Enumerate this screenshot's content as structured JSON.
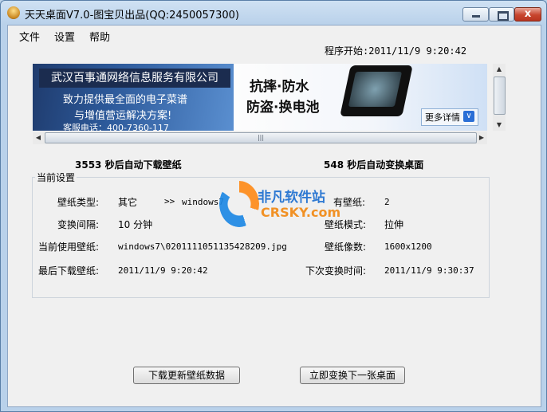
{
  "window": {
    "title": "天天桌面V7.0-图宝贝出品(QQ:2450057300)",
    "close_glyph": "x"
  },
  "menu": [
    "文件",
    "设置",
    "帮助"
  ],
  "start_time": "程序开始:2011/11/9 9:20:42",
  "ad": {
    "company": "武汉百事通网络信息服务有限公司",
    "slogan1": "致力提供最全面的电子菜谱",
    "slogan2": "与增值营运解决方案!",
    "phone": "客服电话：400-7360-117",
    "feature1": "抗摔·防水",
    "feature2": "防盗·换电池",
    "more": "更多详情"
  },
  "countdown": {
    "download": "3553 秒后自动下载壁纸",
    "change": "548 秒后自动变换桌面"
  },
  "settings": {
    "group_title": "当前设置",
    "type_label": "壁纸类型:",
    "type_value": "其它",
    "type_arrow": ">>",
    "type_folder": "windows7",
    "count_label": "有壁纸:",
    "count_value": "2",
    "interval_label": "变换间隔:",
    "interval_value": "10 分钟",
    "mode_label": "壁纸模式:",
    "mode_value": "拉伸",
    "current_label": "当前使用壁纸:",
    "current_value": "windows7\\0201111051135428209.jpg",
    "size_label": "壁纸像数:",
    "size_value": "1600x1200",
    "last_dl_label": "最后下载壁纸:",
    "last_dl_value": "2011/11/9 9:20:42",
    "next_label": "下次变换时间:",
    "next_value": "2011/11/9 9:30:37"
  },
  "watermark": {
    "cn": "非凡软件站",
    "en": "CRSKY.com"
  },
  "buttons": {
    "download": "下载更新壁纸数据",
    "switch_now": "立即变换下一张桌面"
  }
}
